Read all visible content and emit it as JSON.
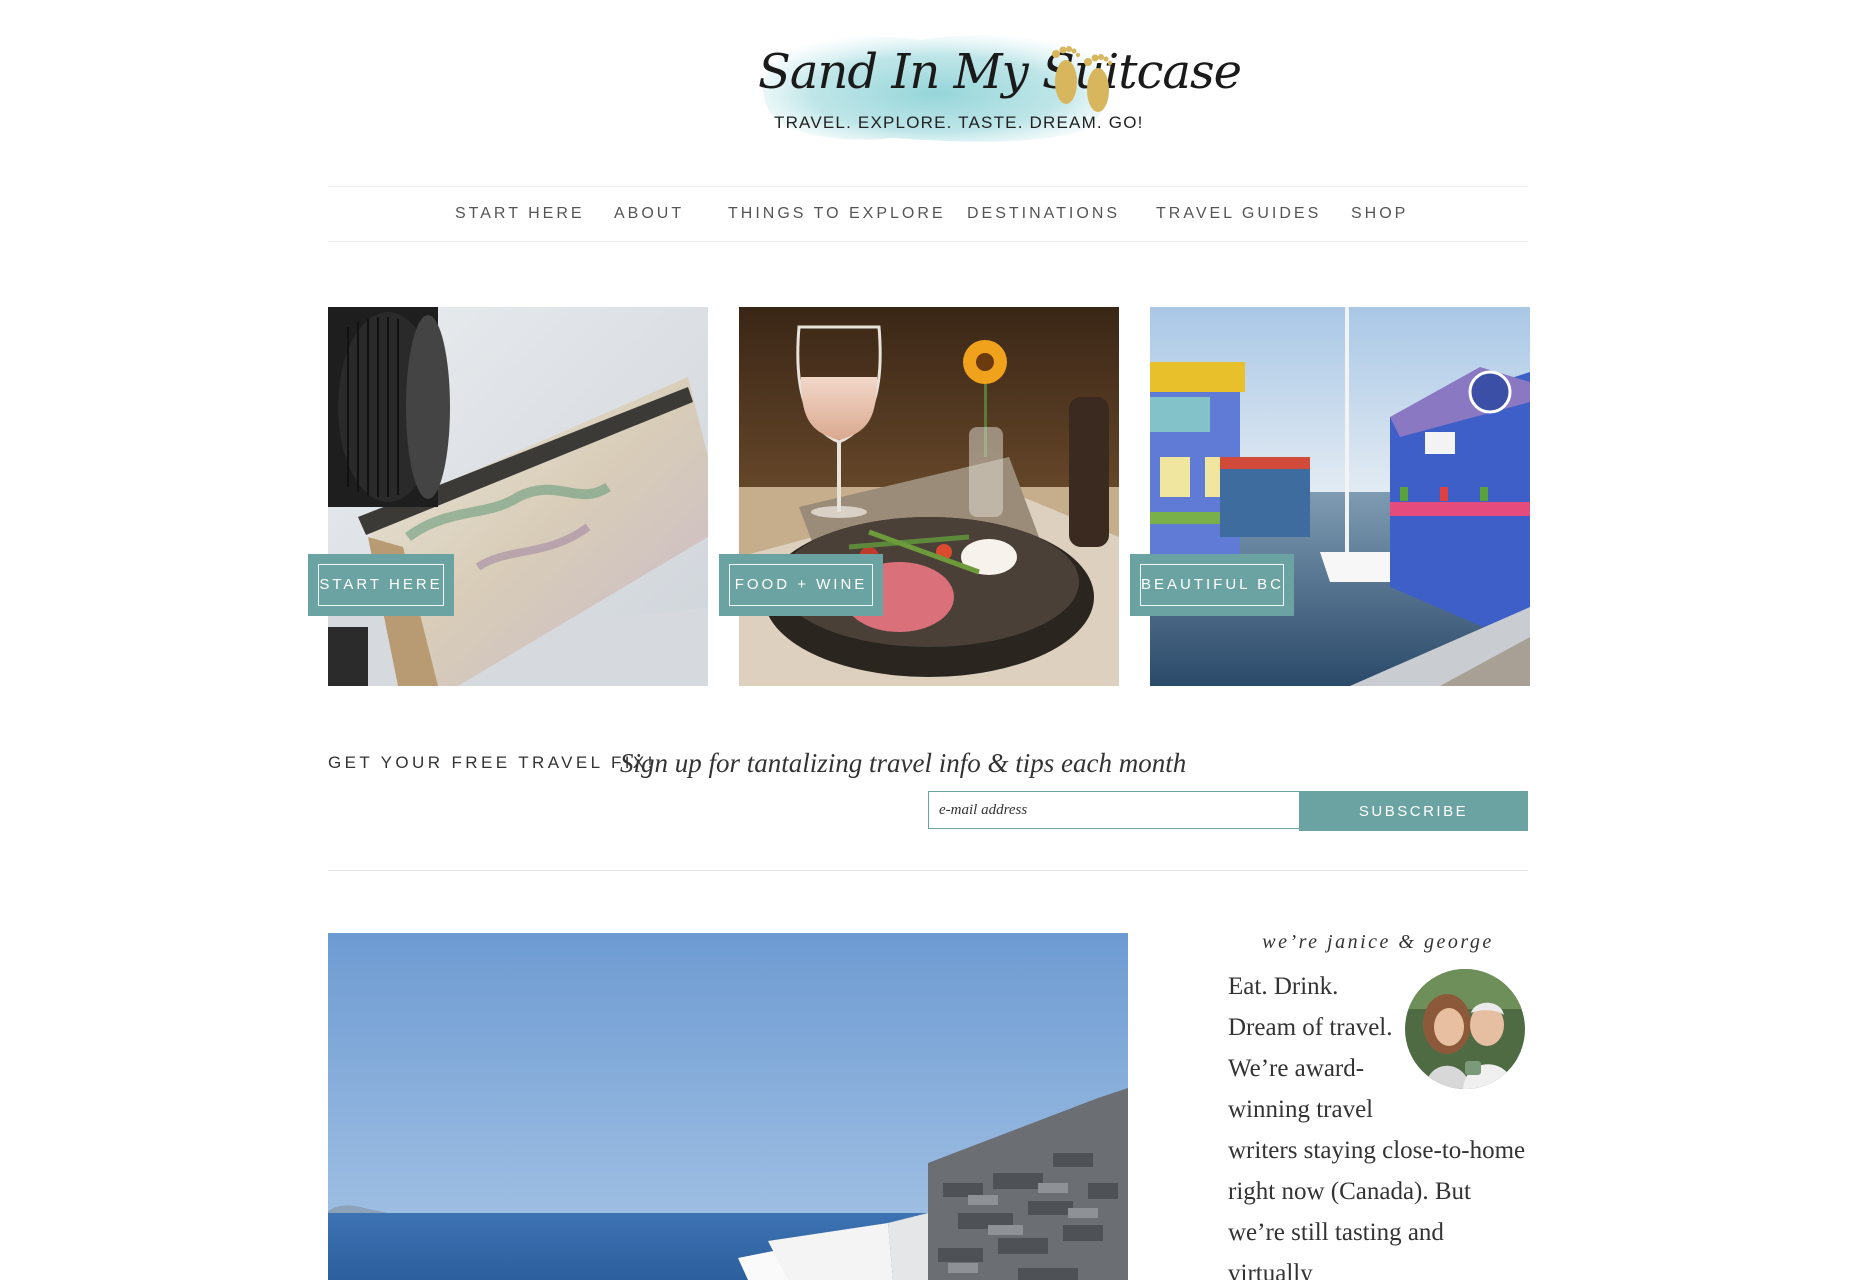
{
  "brand": {
    "name": "Sand In My Suitcase",
    "tagline": "TRAVEL. EXPLORE. TASTE. DREAM. GO!",
    "accent_color": "#6ba3a2",
    "logo_icon": "footprints-icon"
  },
  "nav": {
    "items": [
      {
        "label": "START HERE"
      },
      {
        "label": "ABOUT"
      },
      {
        "label": "THINGS TO EXPLORE"
      },
      {
        "label": "DESTINATIONS"
      },
      {
        "label": "TRAVEL GUIDES"
      },
      {
        "label": "SHOP"
      }
    ]
  },
  "features": [
    {
      "label": "START HERE",
      "image": "map-journal-camera-photo"
    },
    {
      "label": "FOOD + WINE",
      "image": "wine-and-salad-photo"
    },
    {
      "label": "BEAUTIFUL BC",
      "image": "colorful-houseboats-marina-photo"
    }
  ],
  "newsletter": {
    "heading": "GET YOUR FREE TRAVEL FIX!",
    "tagline": "Sign up for tantalizing travel info & tips each month",
    "email_placeholder": "e-mail address",
    "subscribe_label": "SUBSCRIBE"
  },
  "main": {
    "hero_image": "seaside-white-terrace-stone-wall-photo"
  },
  "sidebar": {
    "heading": "we’re janice & george",
    "bio": "Eat. Drink. Dream of travel. We’re award-winning travel writers staying close-to-home right now (Canada). But we’re still tasting and virtually",
    "avatar": "janice-and-george-portrait"
  }
}
